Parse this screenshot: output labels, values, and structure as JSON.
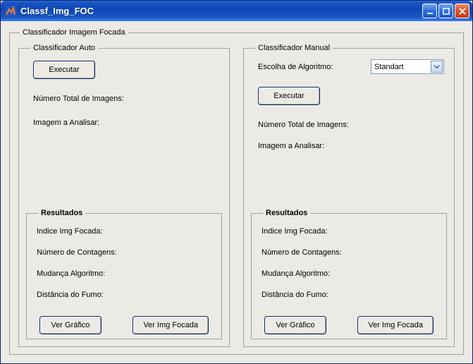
{
  "window": {
    "title": "Classf_Img_FOC"
  },
  "outer": {
    "legend": "Classificador Imagem Focada"
  },
  "auto": {
    "legend": "Classificador Auto",
    "exec": "Executar",
    "total": "Número Total de Imagens:",
    "analisar": "Imagem a Analisar:",
    "results": {
      "legend": "Resultados",
      "indice": "Indice Img Focada:",
      "cont": "Número de Contagens:",
      "alg": "Mudança  Algoritmo:",
      "fumo": "Distância do Fumo:",
      "ver_graf": "Ver Gráfico",
      "ver_img": "Ver Img Focada"
    }
  },
  "manual": {
    "legend": "Classificador Manual",
    "escolha": "Escolha de Algoritmo:",
    "algo_selected": "Standart",
    "exec": "Executar",
    "total": "Número Total de Imagens:",
    "analisar": "Imagem a Analisar:",
    "results": {
      "legend": "Resultados",
      "indice": "Indice Img Focada:",
      "cont": "Número de Contagens:",
      "alg": "Mudança  Algoritmo:",
      "fumo": "Distância do Fumo:",
      "ver_graf": "Ver Gráfico",
      "ver_img": "Ver Img Focada"
    }
  }
}
